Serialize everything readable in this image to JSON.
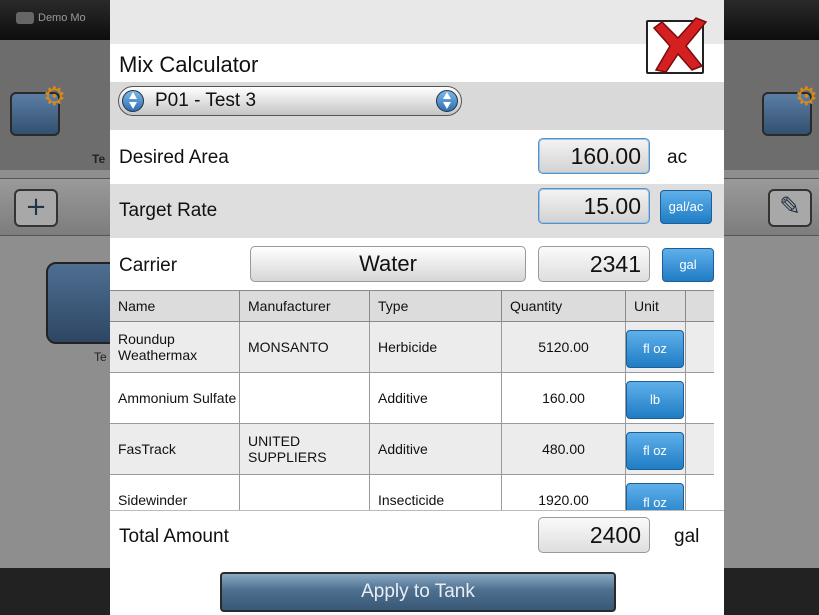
{
  "background": {
    "demo_label": "Demo Mo",
    "te_label": "Te"
  },
  "modal": {
    "title": "Mix Calculator",
    "profile": "P01 - Test 3",
    "desired_area": {
      "label": "Desired Area",
      "value": "160.00",
      "unit": "ac"
    },
    "target_rate": {
      "label": "Target Rate",
      "value": "15.00",
      "unit": "gal/ac"
    },
    "carrier": {
      "label": "Carrier",
      "name": "Water",
      "value": "2341",
      "unit": "gal"
    },
    "table": {
      "headers": [
        "Name",
        "Manufacturer",
        "Type",
        "Quantity",
        "Unit"
      ],
      "rows": [
        {
          "name": "Roundup Weathermax",
          "manufacturer": "MONSANTO",
          "type": "Herbicide",
          "quantity": "5120.00",
          "unit": "fl oz"
        },
        {
          "name": "Ammonium Sulfate",
          "manufacturer": "",
          "type": "Additive",
          "quantity": "160.00",
          "unit": "lb"
        },
        {
          "name": "FasTrack",
          "manufacturer": "UNITED SUPPLIERS",
          "type": "Additive",
          "quantity": "480.00",
          "unit": "fl oz"
        },
        {
          "name": "Sidewinder",
          "manufacturer": "",
          "type": "Insecticide",
          "quantity": "1920.00",
          "unit": "fl oz"
        }
      ]
    },
    "total": {
      "label": "Total Amount",
      "value": "2400",
      "unit": "gal"
    },
    "apply_label": "Apply to Tank"
  },
  "colors": {
    "accent_blue": "#1f7cc4",
    "close_red": "#d42020"
  }
}
